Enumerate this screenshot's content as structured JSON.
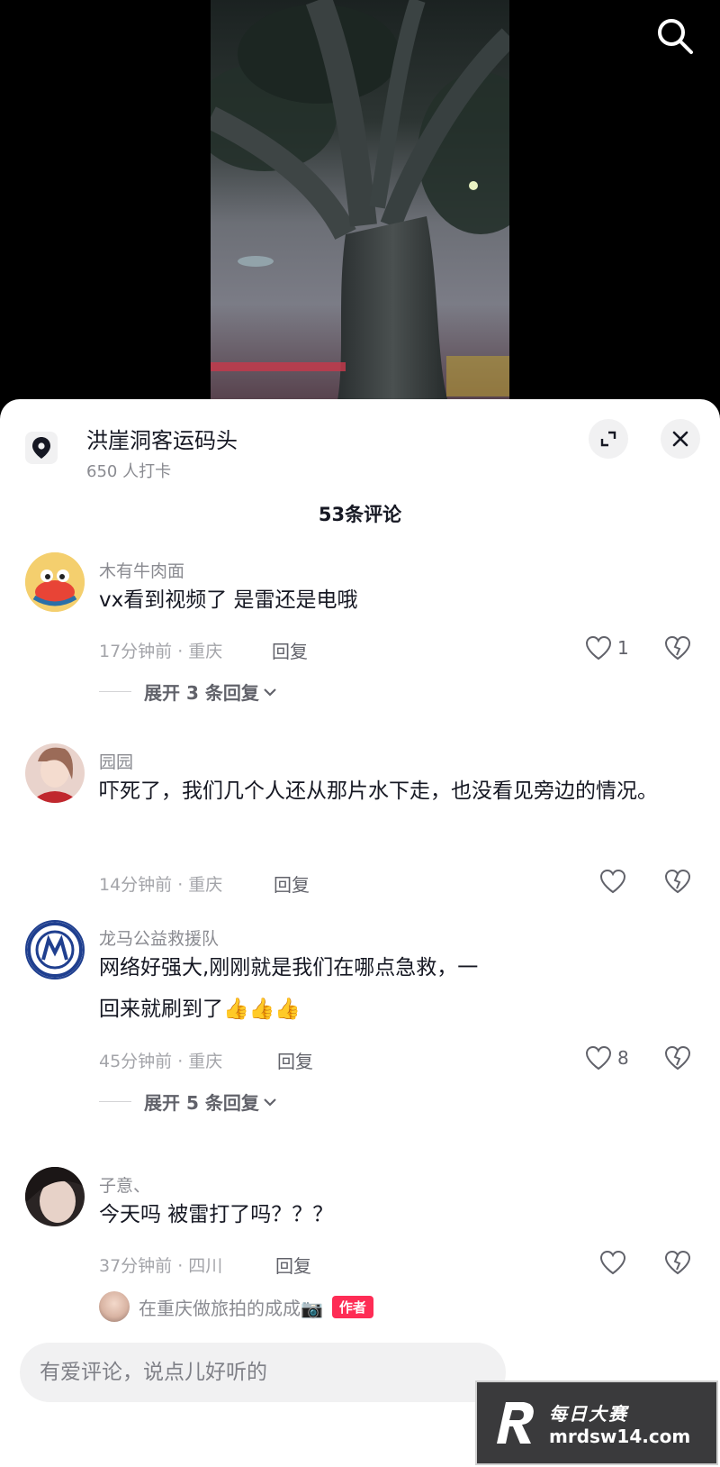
{
  "header": {
    "search_icon": "search-icon"
  },
  "location": {
    "icon": "location-pin-icon",
    "title": "洪崖洞客运码头",
    "checkins": "650 人打卡"
  },
  "comments_header": {
    "count_label": "53条评论"
  },
  "comments": [
    {
      "user": "木有牛肉面",
      "text": "vx看到视频了 是雷还是电哦",
      "time_location": "17分钟前 · 重庆",
      "reply_label": "回复",
      "like_count": "1",
      "expand_label": "展开 3 条回复"
    },
    {
      "user": "园园",
      "text": "吓死了，我们几个人还从那片水下走，也没看见旁边的情况。",
      "time_location": "14分钟前 · 重庆",
      "reply_label": "回复",
      "like_count": ""
    },
    {
      "user": "龙马公益救援队",
      "text": "网络好强大,刚刚就是我们在哪点急救，一回来就刷到了👍👍👍",
      "time_location": "45分钟前 · 重庆",
      "reply_label": "回复",
      "like_count": "8",
      "expand_label": "展开 5 条回复"
    },
    {
      "user": "子意、",
      "text": "今天吗 被雷打了吗？？？",
      "time_location": "37分钟前 · 四川",
      "reply_label": "回复",
      "like_count": ""
    }
  ],
  "author_reply": {
    "name": "在重庆做旅拍的成成📷",
    "badge": "作者"
  },
  "input": {
    "placeholder": "有爱评论，说点儿好听的"
  },
  "watermark": {
    "title": "每日大赛",
    "url": "mrdsw14.com"
  },
  "colors": {
    "accent": "#fe2c55",
    "text_primary": "#161823",
    "text_secondary": "#8a8b91"
  }
}
